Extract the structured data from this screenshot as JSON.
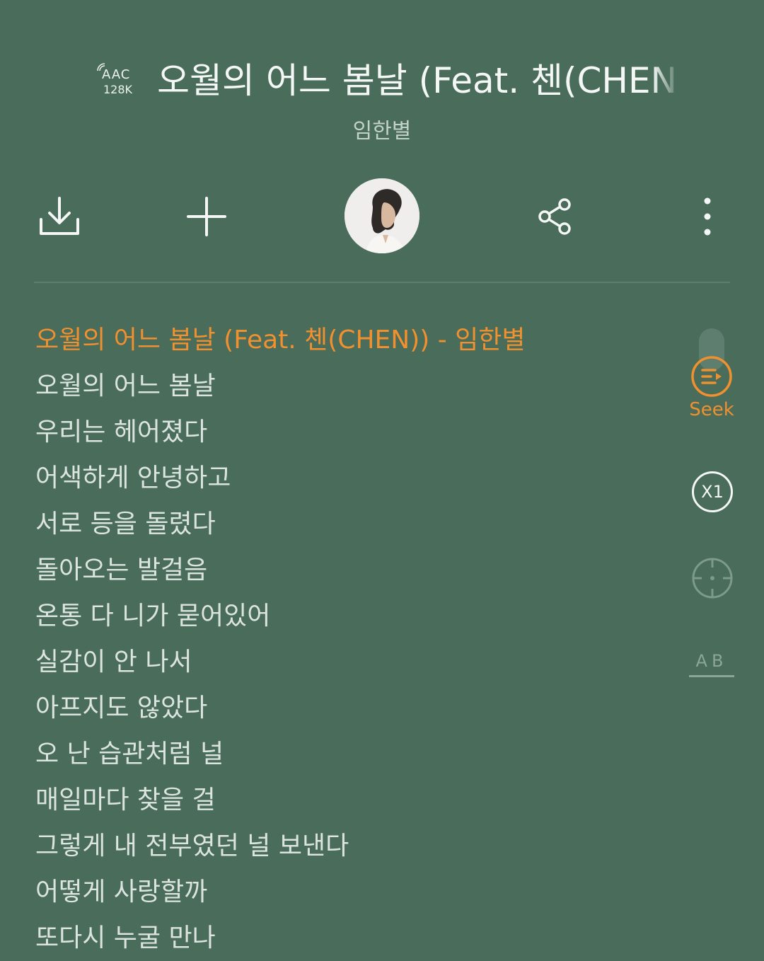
{
  "player": {
    "quality": {
      "codec": "AAC",
      "bitrate": "128K",
      "icon": "streaming-wave-icon"
    },
    "song_title": "오월의 어느 봄날 (Feat. 첸(CHEN))",
    "artist": "임한별"
  },
  "toolbar": {
    "download_icon": "download-icon",
    "add_icon": "plus-icon",
    "artist_avatar_icon": "artist-avatar",
    "share_icon": "share-icon",
    "more_icon": "more-vertical-icon"
  },
  "lyrics": {
    "current_line": "오월의 어느 봄날 (Feat. 첸(CHEN)) - 임한별",
    "lines": [
      "오월의 어느 봄날",
      "우리는 헤어졌다",
      "어색하게 안녕하고",
      "서로 등을 돌렸다",
      "돌아오는 발걸음",
      "온통 다 니가 묻어있어",
      "실감이 안 나서",
      "아프지도 않았다",
      "오 난 습관처럼 널",
      "매일마다 찾을 걸",
      "그렇게 내 전부였던 널 보낸다",
      "어떻게 사랑할까",
      "또다시 누굴 만나"
    ]
  },
  "side_tools": {
    "seek_label": "Seek",
    "speed_label": "X1",
    "ab_label": "AB"
  },
  "colors": {
    "background": "#496c5b",
    "accent": "#f0902e",
    "text": "#dbe4de",
    "muted": "#8ba596"
  }
}
